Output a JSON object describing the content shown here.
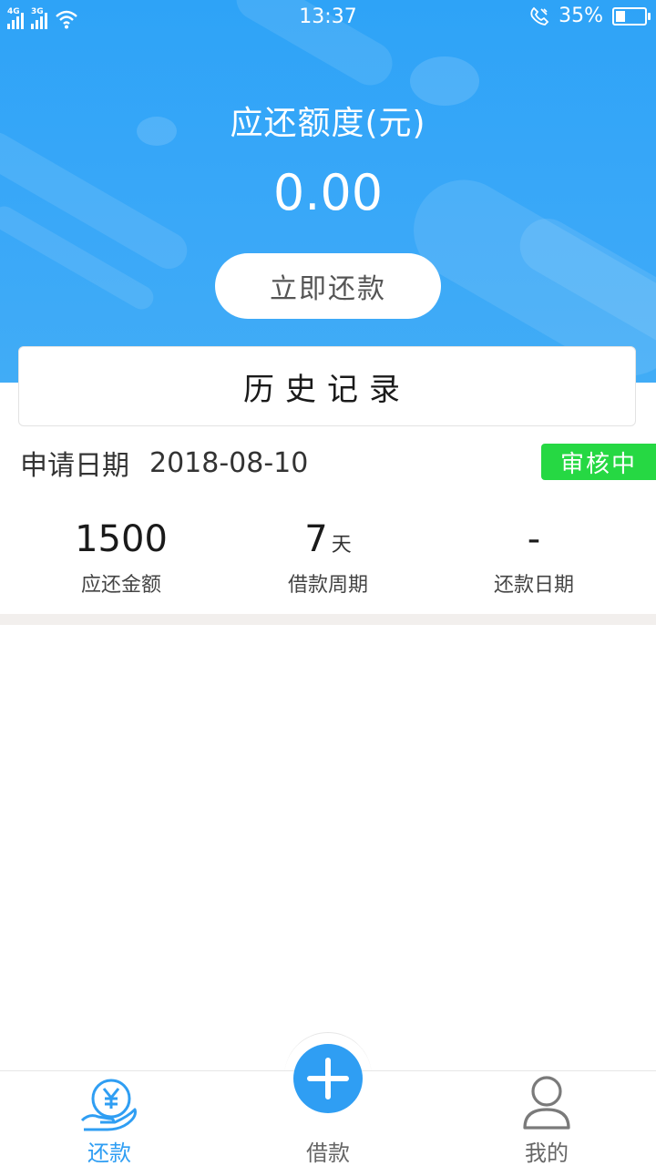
{
  "status_bar": {
    "network_1": "4G",
    "network_2": "3G",
    "time": "13:37",
    "battery": "35%",
    "battery_level": 0.35
  },
  "header": {
    "title": "应还额度(元)",
    "amount": "0.00",
    "repay_button": "立即还款"
  },
  "history": {
    "title": "历史记录"
  },
  "record": {
    "date_label": "申请日期",
    "date_value": "2018-08-10",
    "status": "审核中",
    "status_color": "#26d843",
    "amount_value": "1500",
    "amount_label": "应还金额",
    "period_value": "7",
    "period_unit": "天",
    "period_label": "借款周期",
    "repay_date_value": "-",
    "repay_date_label": "还款日期"
  },
  "nav": {
    "repay": "还款",
    "borrow": "借款",
    "mine": "我的",
    "accent": "#2f9ef3"
  }
}
